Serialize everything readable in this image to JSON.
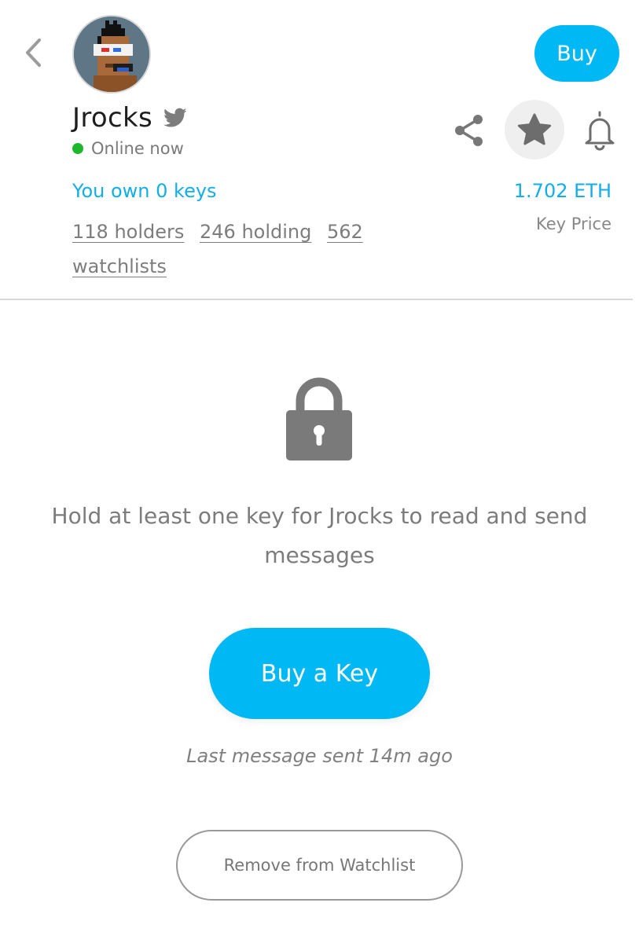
{
  "header": {
    "buy_label": "Buy",
    "back_icon": "chevron-left-icon"
  },
  "profile": {
    "name": "Jrocks",
    "status": "Online now",
    "status_color": "#1db62d",
    "avatar": "pixel-art-avatar-with-3d-glasses",
    "social_icon": "twitter-icon"
  },
  "keys": {
    "own_text": "You own 0 keys",
    "holders": "118 holders",
    "holding": "246 holding",
    "watchlists": "562 watchlists",
    "price": "1.702 ETH",
    "price_label": "Key Price"
  },
  "actions": {
    "share_icon": "share-icon",
    "star_icon": "star-icon",
    "bell_icon": "bell-icon"
  },
  "locked": {
    "icon": "lock-icon",
    "message": "Hold at least one key for Jrocks to read and send messages",
    "buy_key_label": "Buy a Key",
    "last_message": "Last message sent 14m ago",
    "remove_label": "Remove from Watchlist"
  },
  "colors": {
    "accent": "#00b8f4",
    "link": "#12aee8",
    "muted": "#7c7c7c"
  }
}
